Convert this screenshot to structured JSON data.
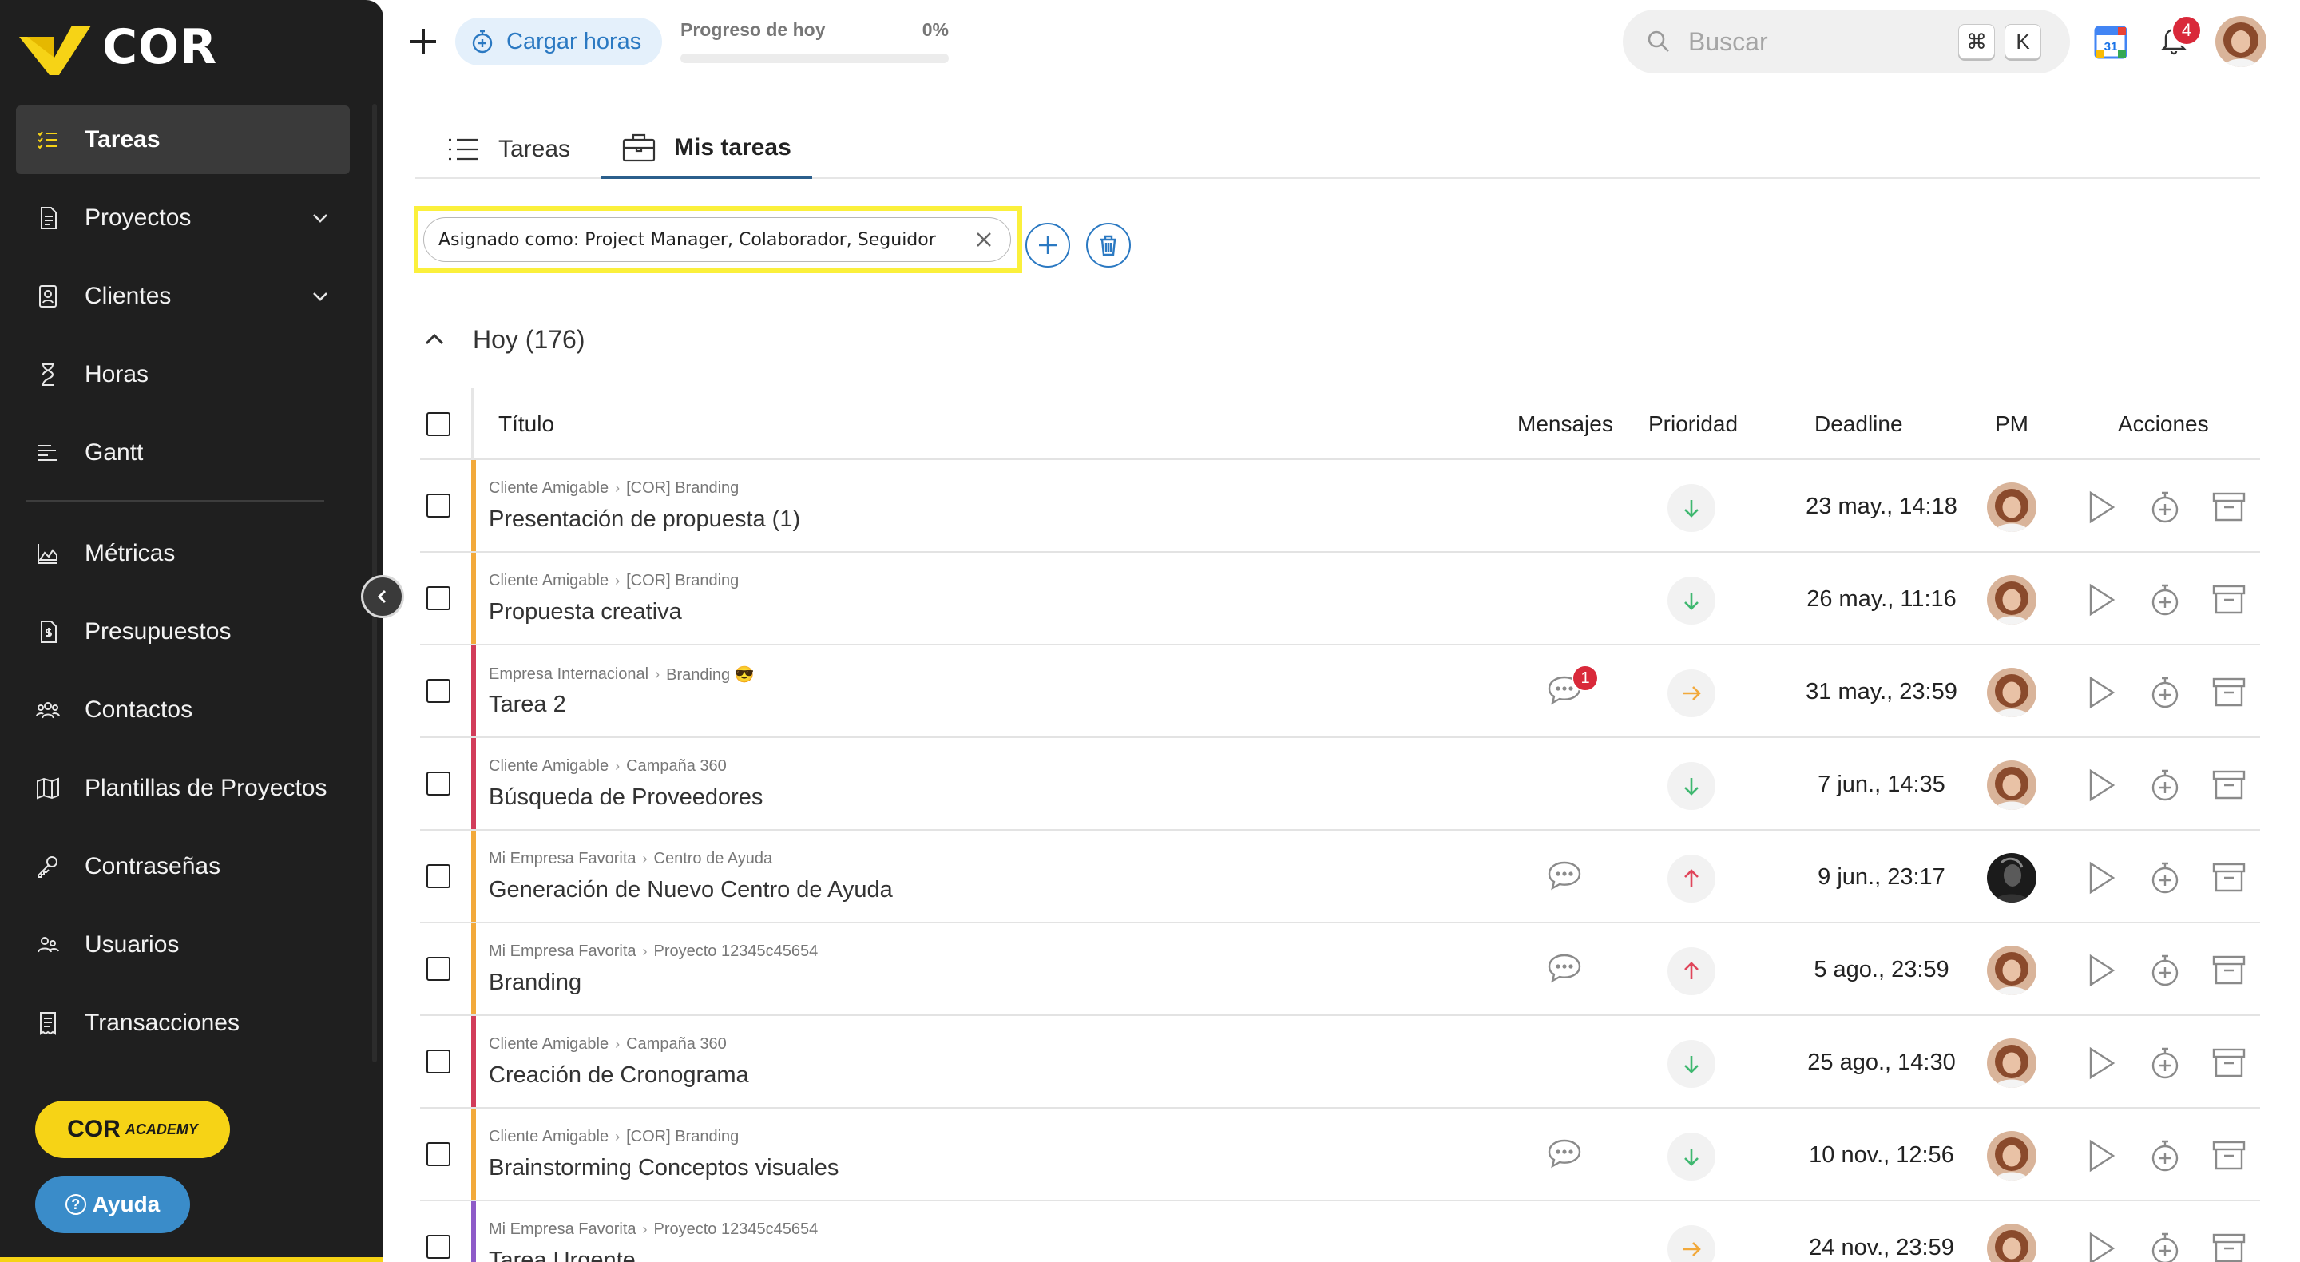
{
  "sidebar": {
    "logo_text": "COR",
    "items": [
      {
        "label": "Tareas",
        "icon": "list-check-icon",
        "active": true
      },
      {
        "label": "Proyectos",
        "icon": "document-icon",
        "chevron": true
      },
      {
        "label": "Clientes",
        "icon": "contact-card-icon",
        "chevron": true
      },
      {
        "label": "Horas",
        "icon": "hourglass-icon"
      },
      {
        "label": "Gantt",
        "icon": "gantt-icon"
      },
      {
        "label": "Métricas",
        "icon": "area-chart-icon"
      },
      {
        "label": "Presupuestos",
        "icon": "budget-icon"
      },
      {
        "label": "Contactos",
        "icon": "group-icon"
      },
      {
        "label": "Plantillas de Proyectos",
        "icon": "map-icon"
      },
      {
        "label": "Contraseñas",
        "icon": "key-icon"
      },
      {
        "label": "Usuarios",
        "icon": "users-icon"
      },
      {
        "label": "Transacciones",
        "icon": "receipt-icon"
      }
    ],
    "academy_label": "COR",
    "academy_sub": "ACADEMY",
    "help_label": "Ayuda"
  },
  "topbar": {
    "cargar_label": "Cargar horas",
    "progress_label": "Progreso de hoy",
    "progress_value": "0%",
    "progress_fraction": 0,
    "search_placeholder": "Buscar",
    "kbd_cmd": "⌘",
    "kbd_k": "K",
    "calendar_day": "31",
    "notifications": "4"
  },
  "tabs": [
    {
      "label": "Tareas",
      "active": false
    },
    {
      "label": "Mis tareas",
      "active": true
    }
  ],
  "filter": {
    "chip_label": "Asignado como: Project Manager, Colaborador, Seguidor"
  },
  "group": {
    "label": "Hoy (176)"
  },
  "table": {
    "columns": {
      "title": "Título",
      "messages": "Mensajes",
      "priority": "Prioridad",
      "deadline": "Deadline",
      "pm": "PM",
      "actions": "Acciones"
    },
    "rows": [
      {
        "client": "Cliente Amigable",
        "project": "[COR] Branding",
        "title": "Presentación de propuesta (1)",
        "messages": "",
        "priority": "low",
        "deadline": "23 may., 14:18",
        "color": "#f2a93b",
        "pm": "woman"
      },
      {
        "client": "Cliente Amigable",
        "project": "[COR] Branding",
        "title": "Propuesta creativa",
        "messages": "",
        "priority": "low",
        "deadline": "26 may., 11:16",
        "color": "#f2a93b",
        "pm": "woman"
      },
      {
        "client": "Empresa Internacional",
        "project": "Branding 😎",
        "title": "Tarea 2",
        "messages": "1",
        "priority": "medium",
        "deadline": "31 may., 23:59",
        "color": "#d23c5a",
        "pm": "woman"
      },
      {
        "client": "Cliente Amigable",
        "project": "Campaña 360",
        "title": "Búsqueda de Proveedores",
        "messages": "",
        "priority": "low",
        "deadline": "7 jun., 14:35",
        "color": "#d23c5a",
        "pm": "woman"
      },
      {
        "client": "Mi Empresa Favorita",
        "project": "Centro de Ayuda",
        "title": "Generación de Nuevo Centro de Ayuda",
        "messages": "0",
        "priority": "high",
        "deadline": "9 jun., 23:17",
        "color": "#f2a93b",
        "pm": "dark"
      },
      {
        "client": "Mi Empresa Favorita",
        "project": "Proyecto 12345c45654",
        "title": "Branding",
        "messages": "0",
        "priority": "high",
        "deadline": "5 ago., 23:59",
        "color": "#f2a93b",
        "pm": "woman"
      },
      {
        "client": "Cliente Amigable",
        "project": "Campaña 360",
        "title": "Creación de Cronograma",
        "messages": "",
        "priority": "low",
        "deadline": "25 ago., 14:30",
        "color": "#d23c5a",
        "pm": "woman"
      },
      {
        "client": "Cliente Amigable",
        "project": "[COR] Branding",
        "title": "Brainstorming Conceptos visuales",
        "messages": "0",
        "priority": "low",
        "deadline": "10 nov., 12:56",
        "color": "#f2a93b",
        "pm": "woman"
      },
      {
        "client": "Mi Empresa Favorita",
        "project": "Proyecto 12345c45654",
        "title": "Tarea Urgente",
        "messages": "",
        "priority": "medium",
        "deadline": "24 nov., 23:59",
        "color": "#8e5bc8",
        "pm": "woman"
      }
    ]
  },
  "colors": {
    "accent": "#2b79c2",
    "highlight": "#fbf03c",
    "brand_yellow": "#f6d316",
    "priority_low": "#3fb870",
    "priority_medium": "#f2a93b",
    "priority_high": "#e0455a"
  }
}
